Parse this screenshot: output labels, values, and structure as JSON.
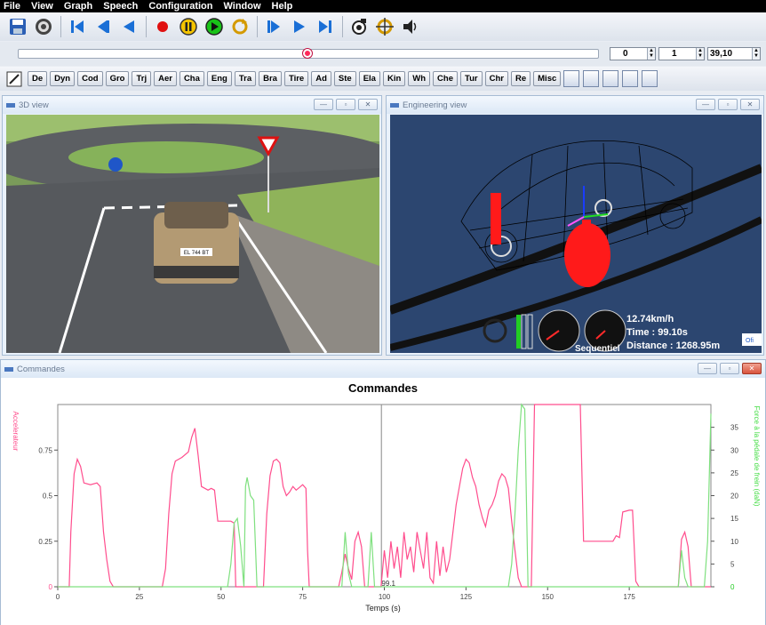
{
  "menu": [
    "File",
    "View",
    "Graph",
    "Speech",
    "Configuration",
    "Window",
    "Help"
  ],
  "toolbar": {
    "icons": [
      "save-icon",
      "settings-icon",
      "skip-start-icon",
      "step-back-icon",
      "rewind-icon",
      "record-icon",
      "pause-icon",
      "play-icon",
      "loop-icon",
      "forward-icon",
      "step-forward-icon",
      "skip-end-icon",
      "camera-icon",
      "target-icon",
      "speaker-icon"
    ]
  },
  "playback": {
    "position": 0.5,
    "spin_a": "0",
    "spin_b": "1",
    "spin_c": "39,10"
  },
  "modules": [
    "De",
    "Dyn",
    "Cod",
    "Gro",
    "Trj",
    "Aer",
    "Cha",
    "Eng",
    "Tra",
    "Bra",
    "Tire",
    "Ad",
    "Ste",
    "Ela",
    "Kin",
    "Wh",
    "Che",
    "Tur",
    "Chr",
    "Re",
    "Misc"
  ],
  "panels": {
    "view3d_title": "3D view",
    "engineering_title": "Engineering view",
    "commandes_title": "Commandes"
  },
  "plate": "EL 744 BT",
  "hud": {
    "speed": "12.74km/h",
    "time": "Time : 99.10s",
    "distance": "Distance : 1268.95m",
    "gear_mode": "Sequentiel",
    "side_tag": "Ofi"
  },
  "chart_data": {
    "type": "line",
    "title": "Commandes",
    "xlabel": "Temps (s)",
    "ylabel_left": "Accelerateur",
    "ylabel_right": "Force à la pédale de frein (daN)",
    "xlim": [
      0,
      200
    ],
    "ylim_left": [
      0,
      1
    ],
    "ylim_right": [
      0,
      40
    ],
    "x_ticks": [
      "0",
      "25",
      "50",
      "75",
      "100",
      "125",
      "150",
      "175"
    ],
    "y_ticks_left": [
      "0",
      "0.25",
      "0.5",
      "0.75"
    ],
    "y_ticks_right": [
      "0",
      "5",
      "10",
      "15",
      "20",
      "25",
      "30",
      "35"
    ],
    "cursor": {
      "x": 99.1,
      "label": "99.1"
    },
    "series": [
      {
        "name": "Accelerateur",
        "axis": "left",
        "color": "#ff4d8d",
        "points": [
          [
            0,
            0
          ],
          [
            3.5,
            0
          ],
          [
            4,
            0.3
          ],
          [
            5,
            0.62
          ],
          [
            6,
            0.7
          ],
          [
            7,
            0.66
          ],
          [
            8,
            0.57
          ],
          [
            10,
            0.56
          ],
          [
            12,
            0.57
          ],
          [
            13,
            0.55
          ],
          [
            14,
            0.3
          ],
          [
            15,
            0.15
          ],
          [
            16,
            0.03
          ],
          [
            17,
            0
          ],
          [
            32,
            0
          ],
          [
            33,
            0.1
          ],
          [
            34,
            0.4
          ],
          [
            35,
            0.62
          ],
          [
            36,
            0.69
          ],
          [
            38,
            0.71
          ],
          [
            40,
            0.74
          ],
          [
            41,
            0.82
          ],
          [
            42,
            0.87
          ],
          [
            43,
            0.72
          ],
          [
            44,
            0.55
          ],
          [
            46,
            0.53
          ],
          [
            47,
            0.54
          ],
          [
            48,
            0.53
          ],
          [
            49,
            0.36
          ],
          [
            53,
            0.36
          ],
          [
            54,
            0.35
          ],
          [
            54.5,
            0
          ],
          [
            63,
            0
          ],
          [
            64,
            0.4
          ],
          [
            65,
            0.61
          ],
          [
            66,
            0.69
          ],
          [
            67,
            0.7
          ],
          [
            68,
            0.68
          ],
          [
            69,
            0.55
          ],
          [
            70,
            0.5
          ],
          [
            71,
            0.52
          ],
          [
            72,
            0.55
          ],
          [
            73,
            0.53
          ],
          [
            75,
            0.56
          ],
          [
            76,
            0.54
          ],
          [
            76.5,
            0.2
          ],
          [
            77,
            0
          ],
          [
            86,
            0
          ],
          [
            87,
            0.08
          ],
          [
            88,
            0.18
          ],
          [
            89,
            0.1
          ],
          [
            90,
            0.04
          ],
          [
            91,
            0.25
          ],
          [
            92,
            0.3
          ],
          [
            93,
            0.22
          ],
          [
            94,
            0
          ],
          [
            99,
            0
          ],
          [
            100,
            0.2
          ],
          [
            101,
            0.05
          ],
          [
            102,
            0.25
          ],
          [
            103,
            0.1
          ],
          [
            104,
            0.22
          ],
          [
            105,
            0.05
          ],
          [
            106,
            0.3
          ],
          [
            107,
            0.15
          ],
          [
            108,
            0.22
          ],
          [
            109,
            0.08
          ],
          [
            110,
            0.3
          ],
          [
            111,
            0.2
          ],
          [
            112,
            0.1
          ],
          [
            113,
            0.3
          ],
          [
            114,
            0.05
          ],
          [
            115,
            0.02
          ],
          [
            116,
            0.25
          ],
          [
            117,
            0.06
          ],
          [
            118,
            0.22
          ],
          [
            119,
            0.08
          ],
          [
            120,
            0.15
          ],
          [
            121,
            0.3
          ],
          [
            122,
            0.45
          ],
          [
            123,
            0.55
          ],
          [
            124,
            0.65
          ],
          [
            125,
            0.7
          ],
          [
            126,
            0.68
          ],
          [
            127,
            0.6
          ],
          [
            128,
            0.55
          ],
          [
            129,
            0.45
          ],
          [
            130,
            0.38
          ],
          [
            131,
            0.33
          ],
          [
            132,
            0.42
          ],
          [
            133,
            0.45
          ],
          [
            134,
            0.5
          ],
          [
            135,
            0.58
          ],
          [
            136,
            0.62
          ],
          [
            137,
            0.6
          ],
          [
            138,
            0.54
          ],
          [
            139,
            0.36
          ],
          [
            140,
            0.2
          ],
          [
            141,
            0.05
          ],
          [
            142,
            0
          ],
          [
            145,
            0
          ],
          [
            146,
            1.0
          ],
          [
            155,
            1.0
          ],
          [
            156,
            1.0
          ],
          [
            160,
            1.0
          ],
          [
            161,
            0.25
          ],
          [
            170,
            0.25
          ],
          [
            171,
            0.28
          ],
          [
            172,
            0.27
          ],
          [
            173,
            0.41
          ],
          [
            175,
            0.42
          ],
          [
            176,
            0.42
          ],
          [
            177,
            0.03
          ],
          [
            178,
            0
          ],
          [
            190,
            0
          ],
          [
            191,
            0.26
          ],
          [
            192,
            0.3
          ],
          [
            193,
            0.22
          ],
          [
            194,
            0
          ],
          [
            200,
            0
          ]
        ]
      },
      {
        "name": "Force à la pédale de frein",
        "axis": "right",
        "color": "#7fe07f",
        "points": [
          [
            0,
            0
          ],
          [
            52,
            0
          ],
          [
            53,
            5
          ],
          [
            54,
            14
          ],
          [
            55,
            15
          ],
          [
            56,
            9
          ],
          [
            57,
            0
          ],
          [
            57.5,
            22
          ],
          [
            58,
            24
          ],
          [
            59,
            20
          ],
          [
            60,
            19
          ],
          [
            61,
            0
          ],
          [
            80,
            0
          ],
          [
            87,
            0
          ],
          [
            88,
            12
          ],
          [
            89,
            3
          ],
          [
            90,
            0
          ],
          [
            95,
            0
          ],
          [
            96,
            12
          ],
          [
            97,
            0
          ],
          [
            121,
            0
          ],
          [
            138,
            0
          ],
          [
            139,
            5
          ],
          [
            140,
            16
          ],
          [
            141,
            30
          ],
          [
            142,
            40
          ],
          [
            143,
            39
          ],
          [
            144,
            0
          ],
          [
            145,
            0
          ],
          [
            190,
            0
          ],
          [
            191,
            8
          ],
          [
            192,
            2
          ],
          [
            193,
            0
          ],
          [
            198,
            0
          ],
          [
            199,
            10
          ],
          [
            200,
            38
          ]
        ]
      }
    ]
  }
}
